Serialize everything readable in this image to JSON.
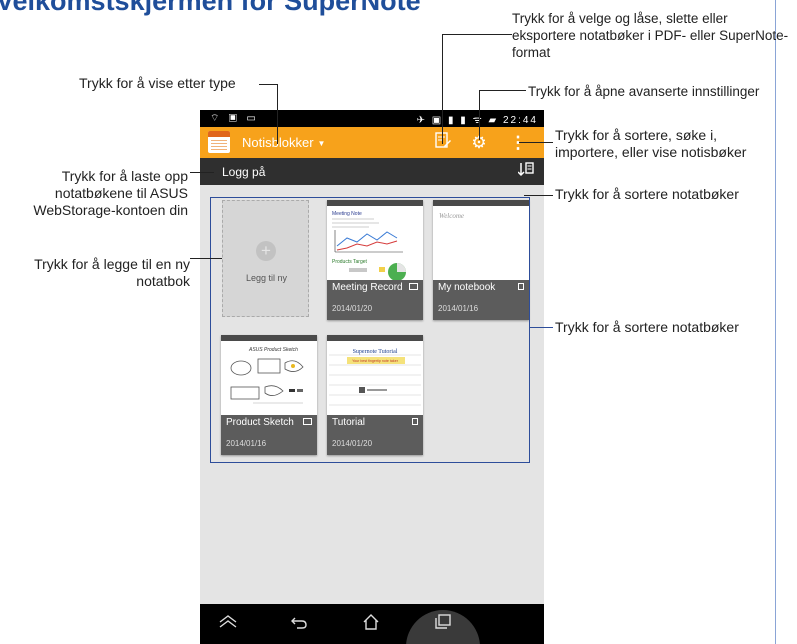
{
  "page_title": "Velkomstskjermen for SuperNote",
  "status_bar": {
    "left_icons": "⌔ ▣ ▭",
    "right_icons": "✈ ▣ ▮ ▮ ᯤ ▰",
    "time": "22:44"
  },
  "action_bar": {
    "spinner_label": "Notisblokker",
    "spinner_caret": "▼"
  },
  "login_bar": {
    "label": "Logg på"
  },
  "add_card": {
    "label": "Legg til ny",
    "icon": "+"
  },
  "notebooks": [
    {
      "name": "Meeting Record",
      "date": "2014/01/20"
    },
    {
      "name": "My notebook",
      "date": "2014/01/16"
    },
    {
      "name": "Product Sketch",
      "date": "2014/01/16"
    },
    {
      "name": "Tutorial",
      "date": "2014/01/20"
    }
  ],
  "thumb_text": {
    "notebook2_script": "Welcome",
    "sketch_title": "ASUS Product Sketch",
    "tutorial_title": "Supernote Tutorial",
    "tutorial_sub": "Your best fingertip note taker",
    "meeting_title": "Meeting Note",
    "meeting_sub": "Products Target"
  },
  "callouts": {
    "view_type": "Trykk for å vise etter type",
    "select_lock": "Trykk for å velge og låse, slette eller eksportere notatbøker i PDF- eller SuperNote-format",
    "advanced": "Trykk for å åpne avanserte innstillinger",
    "sort_search": "Trykk for å sortere, søke i, importere, eller vise notisbøker",
    "sort1": "Trykk for å sortere notatbøker",
    "upload": "Trykk for å laste opp notatbøkene til ASUS WebStorage-kontoen din",
    "add_new": "Trykk for å legge til en ny notatbok",
    "sort2": "Trykk for å sortere notatbøker"
  },
  "icons": {
    "edit": "edit-select-icon",
    "settings": "gear-icon",
    "overflow": "overflow-menu-icon",
    "sort": "sort-icon",
    "back": "back-icon",
    "home": "home-icon",
    "recent": "recent-apps-icon",
    "hide_kb": "hide-keyboard-icon"
  },
  "colors": {
    "action_bar": "#f7a21b",
    "highlight_box": "#2d4d9a",
    "title": "#1f4e9a"
  }
}
